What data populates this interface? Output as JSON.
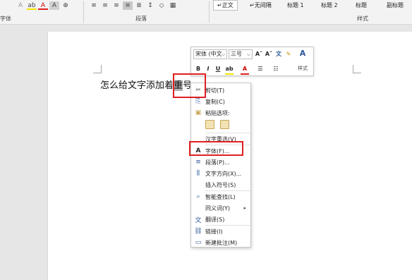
{
  "ribbon": {
    "font_group_label": "字体",
    "paragraph_group_label": "段落",
    "styles_group_label": "样式",
    "styles": [
      "↵正文",
      "↵无间隔",
      "标题 1",
      "标题 2",
      "标题",
      "副标题"
    ]
  },
  "document": {
    "text_before": "怎么给文字添加着",
    "text_selected": "重",
    "text_after": "号",
    "tail_mark": "↵"
  },
  "mini_toolbar": {
    "font_name": "宋体 (中文",
    "font_size": "三号",
    "grow_font": "Aˆ",
    "shrink_font": "Aˇ",
    "bold": "B",
    "italic": "I",
    "underline": "U",
    "styles_label": "样式"
  },
  "context_menu": {
    "items": [
      {
        "label": "剪切(T)",
        "icon": "scissors-icon",
        "glyph": "✂"
      },
      {
        "label": "复制(C)",
        "icon": "copy-icon",
        "glyph": "⎘"
      },
      {
        "label": "粘贴选项:",
        "icon": "paste-icon",
        "glyph": "📋"
      },
      {
        "label": "汉字重选(V)",
        "icon": "",
        "glyph": ""
      },
      {
        "label": "字体(F)...",
        "icon": "font-icon",
        "glyph": "A"
      },
      {
        "label": "段落(P)...",
        "icon": "paragraph-icon",
        "glyph": "≡"
      },
      {
        "label": "文字方向(X)...",
        "icon": "text-direction-icon",
        "glyph": "⫼"
      },
      {
        "label": "插入符号(S)",
        "icon": "",
        "glyph": ""
      },
      {
        "label": "智能查找(L)",
        "icon": "smart-lookup-icon",
        "glyph": "⌕"
      },
      {
        "label": "同义词(Y)",
        "icon": "",
        "glyph": ""
      },
      {
        "label": "翻译(S)",
        "icon": "translate-icon",
        "glyph": "文"
      },
      {
        "label": "链接(I)",
        "icon": "link-icon",
        "glyph": "🔗"
      },
      {
        "label": "新建批注(M)",
        "icon": "comment-icon",
        "glyph": "💬"
      }
    ]
  },
  "colors": {
    "highlight_red": "#e02020",
    "accent_blue": "#2b579a",
    "page_bg": "#ffffff",
    "canvas_bg": "#e6e6e6"
  }
}
